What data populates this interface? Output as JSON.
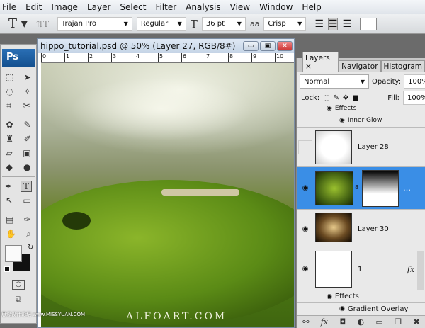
{
  "menu": [
    "File",
    "Edit",
    "Image",
    "Layer",
    "Select",
    "Filter",
    "Analysis",
    "View",
    "Window",
    "Help"
  ],
  "options": {
    "font_family": "Trajan Pro",
    "font_style": "Regular",
    "font_size": "36 pt",
    "antialias": "Crisp",
    "aa_icon": "aa"
  },
  "toolbox": {
    "logo": "Ps"
  },
  "document": {
    "title": "hippo_tutorial.psd @ 50% (Layer 27, RGB/8#)",
    "ruler": [
      "0",
      "1",
      "2",
      "3",
      "4",
      "5",
      "6",
      "7",
      "8",
      "9",
      "10"
    ],
    "watermark": "ALFOART.COM",
    "watermark_cn": "思缘设计论坛 www.MISSYUAN.COM"
  },
  "layers_panel": {
    "tabs": [
      "Layers ×",
      "Navigator",
      "Histogram"
    ],
    "blend_mode": "Normal",
    "opacity_label": "Opacity:",
    "opacity": "100%",
    "lock_label": "Lock:",
    "fill_label": "Fill:",
    "fill": "100%",
    "rows": [
      {
        "name": "Effects"
      },
      {
        "name": "Inner Glow"
      },
      {
        "name": "Layer 28"
      },
      {
        "name": ""
      },
      {
        "name": "Layer 30"
      },
      {
        "name": "1",
        "fx": "fx"
      },
      {
        "name": "Effects"
      },
      {
        "name": "Gradient Overlay"
      }
    ],
    "accent": "#3a8ee6"
  }
}
